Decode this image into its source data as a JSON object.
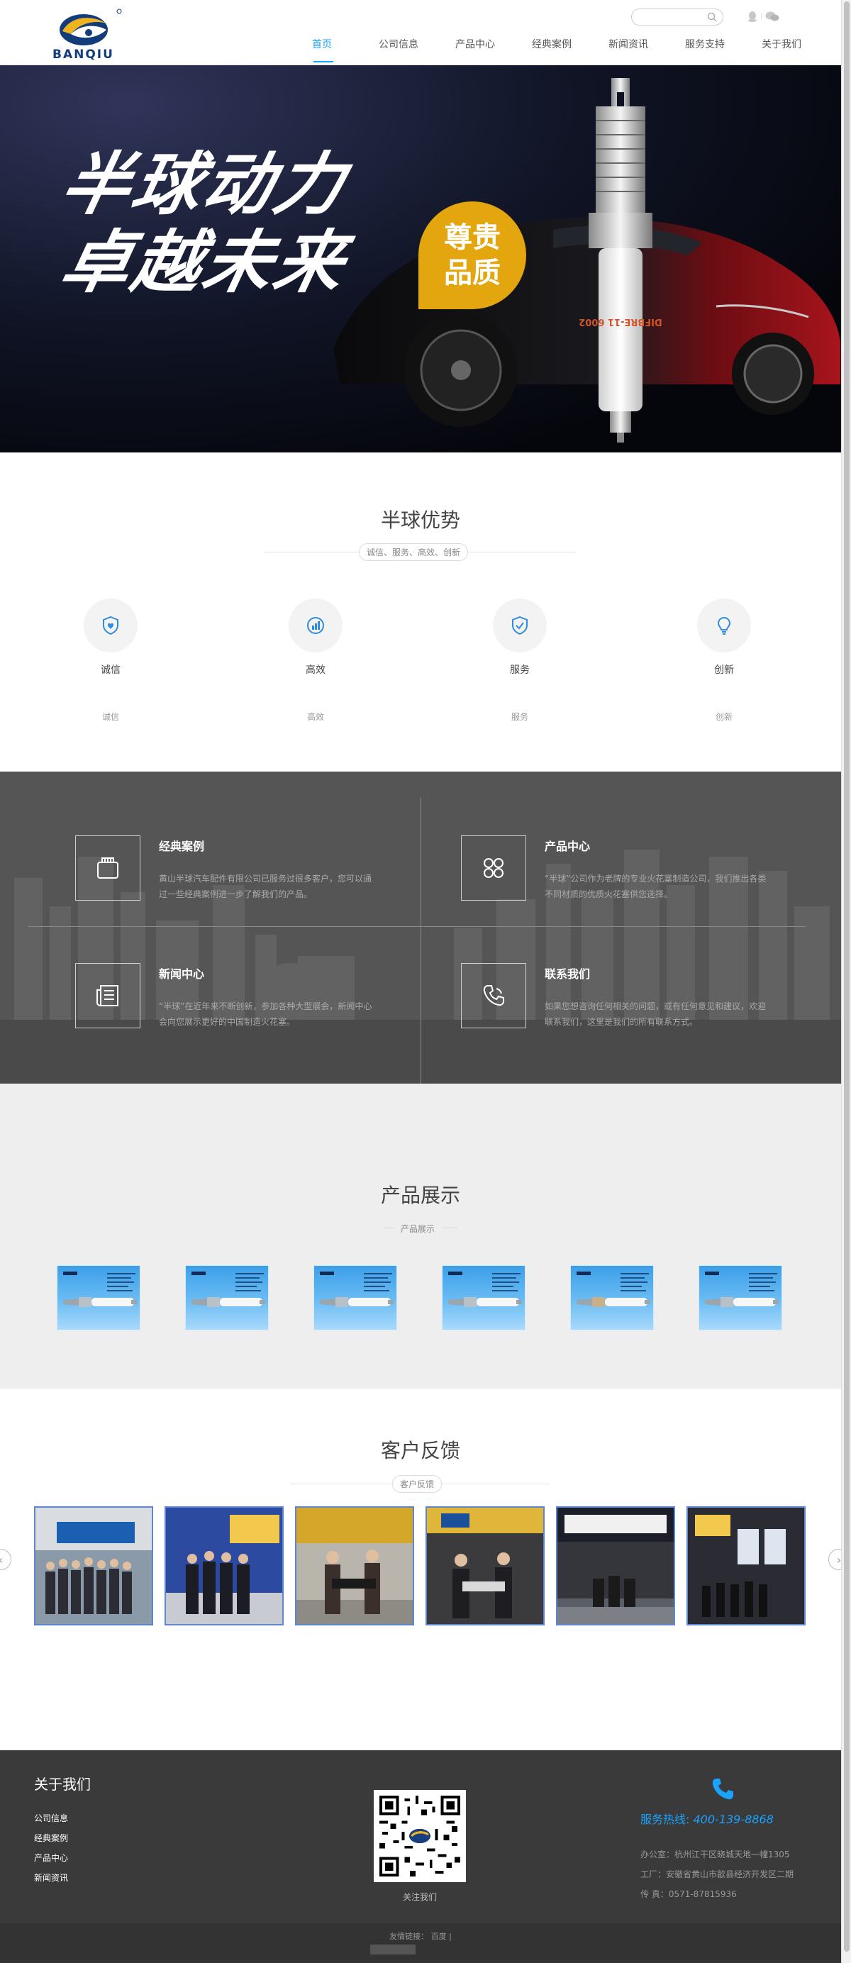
{
  "header": {
    "logo_text": "BANQIU",
    "search_placeholder": "",
    "nav": [
      "首页",
      "公司信息",
      "产品中心",
      "经典案例",
      "新闻资讯",
      "服务支持",
      "关于我们"
    ],
    "active_nav": 0
  },
  "banner": {
    "slogan_line1": "半球动力",
    "slogan_line2": "卓越未来",
    "badge_line1": "尊贵",
    "badge_line2": "品质",
    "plug_text": "DIFBRE-11 6002"
  },
  "advantages": {
    "title": "半球优势",
    "subtitle": "诚信、服务、高效、创新",
    "items": [
      {
        "icon": "shield-heart-icon",
        "title": "诚信",
        "desc": "诚信"
      },
      {
        "icon": "chart-circle-icon",
        "title": "高效",
        "desc": "高效"
      },
      {
        "icon": "shield-check-icon",
        "title": "服务",
        "desc": "服务"
      },
      {
        "icon": "lightbulb-icon",
        "title": "创新",
        "desc": "创新"
      }
    ]
  },
  "grid": {
    "items": [
      {
        "icon": "folder-icon",
        "title": "经典案例",
        "desc": "黄山半球汽车配件有限公司已服务过很多客户，您可以通过一些经典案例进一步了解我们的产品。"
      },
      {
        "icon": "apps-icon",
        "title": "产品中心",
        "desc": "“半球”公司作为老牌的专业火花塞制造公司，我们推出各类不同材质的优质火花塞供您选择。"
      },
      {
        "icon": "newspaper-icon",
        "title": "新闻中心",
        "desc": "“半球”在近年来不断创新，参加各种大型展会，新闻中心会向您展示更好的中国制造火花塞。"
      },
      {
        "icon": "phone-icon",
        "title": "联系我们",
        "desc": "如果您想咨询任何相关的问题，或有任何意见和建议，欢迎联系我们，这里是我们的所有联系方式。"
      }
    ]
  },
  "products": {
    "title": "产品展示",
    "subtitle": "产品展示",
    "count": 6
  },
  "feedback": {
    "title": "客户反馈",
    "subtitle": "客户反馈",
    "prev": "‹",
    "next": "›"
  },
  "footer": {
    "about_title": "关于我们",
    "links": [
      "公司信息",
      "经典案例",
      "产品中心",
      "新闻资讯"
    ],
    "qr_caption": "关注我们",
    "hotline_label": "服务热线:",
    "hotline_number": "400-139-8868",
    "office": "办公室：杭州江干区晓城天地一幢1305",
    "factory": "工厂：安徽省黄山市歙县经济开发区二期",
    "fax": "传 真：0571-87815936",
    "friend_links_label": "友情链接：",
    "friend_links": "百度 |"
  },
  "colors": {
    "accent": "#1aa3ff",
    "badge": "#e3a60f",
    "footer_bg": "#3a3a3a",
    "grid_bg": "#4d4d4d"
  }
}
